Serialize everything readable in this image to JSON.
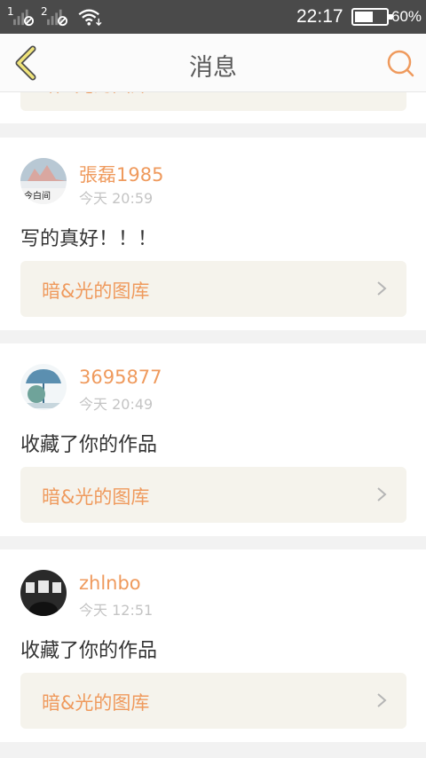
{
  "status_bar": {
    "sim1": "1",
    "sim2": "2",
    "time": "22:17",
    "battery_text": "60%",
    "battery_level": 0.6
  },
  "nav": {
    "title": "消息",
    "back_icon": "chevron-left-icon",
    "search_icon": "search-icon"
  },
  "partial_card": {
    "gallery_label": "暗&光的图库"
  },
  "messages": [
    {
      "username": "張磊1985",
      "time": "今天 20:59",
      "text": "写的真好！！！",
      "gallery_label": "暗&光的图库"
    },
    {
      "username": "3695877",
      "time": "今天 20:49",
      "text": "收藏了你的作品",
      "gallery_label": "暗&光的图库"
    },
    {
      "username": "zhlnbo",
      "time": "今天 12:51",
      "text": "收藏了你的作品",
      "gallery_label": "暗&光的图库"
    }
  ],
  "colors": {
    "accent": "#ef9a5d",
    "status_bar": "#4a4a4a",
    "background": "#f2f2f2",
    "link_bg": "#f5f3ec"
  }
}
